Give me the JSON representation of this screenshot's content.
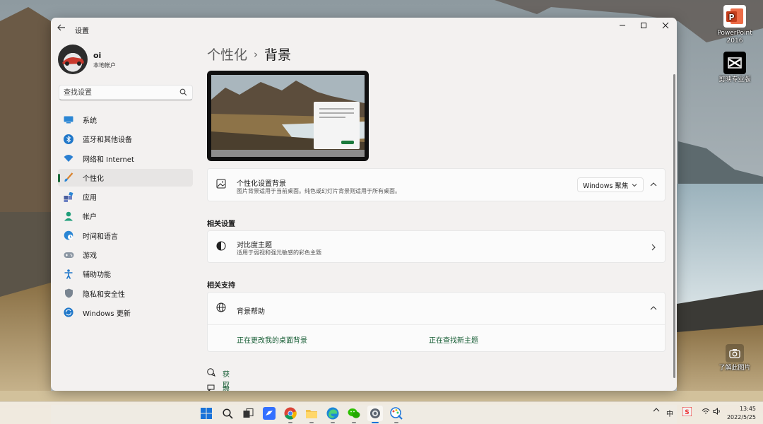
{
  "desktop": {
    "icons": [
      {
        "name": "powerpoint",
        "label": "PowerPoint 2016",
        "icon": "powerpoint-icon"
      },
      {
        "name": "capcut",
        "label": "剪映专业版",
        "icon": "capcut-icon"
      }
    ],
    "camera_widget": {
      "label": "了解此图片",
      "icon": "camera-icon"
    }
  },
  "window": {
    "title": "设置",
    "controls": {
      "minimize": "minimize-icon",
      "maximize": "maximize-icon",
      "close": "close-icon"
    }
  },
  "profile": {
    "name": "oi",
    "account_type": "本地帐户"
  },
  "search": {
    "placeholder": "查找设置",
    "value": ""
  },
  "sidebar": {
    "items": [
      {
        "label": "系统",
        "icon": "system-icon",
        "active": false
      },
      {
        "label": "蓝牙和其他设备",
        "icon": "bluetooth-icon",
        "active": false
      },
      {
        "label": "网络和 Internet",
        "icon": "wifi-icon",
        "active": false
      },
      {
        "label": "个性化",
        "icon": "brush-icon",
        "active": true
      },
      {
        "label": "应用",
        "icon": "apps-icon",
        "active": false
      },
      {
        "label": "帐户",
        "icon": "account-icon",
        "active": false
      },
      {
        "label": "时间和语言",
        "icon": "globe-clock-icon",
        "active": false
      },
      {
        "label": "游戏",
        "icon": "gamepad-icon",
        "active": false
      },
      {
        "label": "辅助功能",
        "icon": "accessibility-icon",
        "active": false
      },
      {
        "label": "隐私和安全性",
        "icon": "shield-icon",
        "active": false
      },
      {
        "label": "Windows 更新",
        "icon": "update-icon",
        "active": false
      }
    ]
  },
  "main": {
    "breadcrumb": {
      "parent": "个性化",
      "separator": "›",
      "current": "背景"
    },
    "background_card": {
      "title": "个性化设置背景",
      "subtitle": "图片背景适用于当前桌面。纯色或幻灯片背景则适用于所有桌面。",
      "selected": "Windows 聚焦"
    },
    "related_settings": {
      "heading": "相关设置",
      "contrast": {
        "title": "对比度主题",
        "subtitle": "适用于弱视和强光敏感的彩色主题"
      }
    },
    "related_support": {
      "heading": "相关支持",
      "help": {
        "title": "背景帮助",
        "links": [
          "正在更改我的桌面背景",
          "正在查找新主题"
        ]
      }
    },
    "footer_links": [
      "获取帮助",
      "提供反馈"
    ]
  },
  "taskbar": {
    "apps": [
      "start-icon",
      "search-icon",
      "task-view-icon",
      "feishu-icon",
      "chrome-icon",
      "file-explorer-icon",
      "edge-icon",
      "wechat-icon",
      "settings-icon",
      "paint-icon"
    ],
    "tray": {
      "ime": "中",
      "time": "13:45",
      "date": "2022/5/25"
    }
  },
  "colors": {
    "accent": "#1b6a3a",
    "link": "#155c33",
    "window_bg": "#f3f1f0",
    "card_bg": "#fbfbfb"
  }
}
